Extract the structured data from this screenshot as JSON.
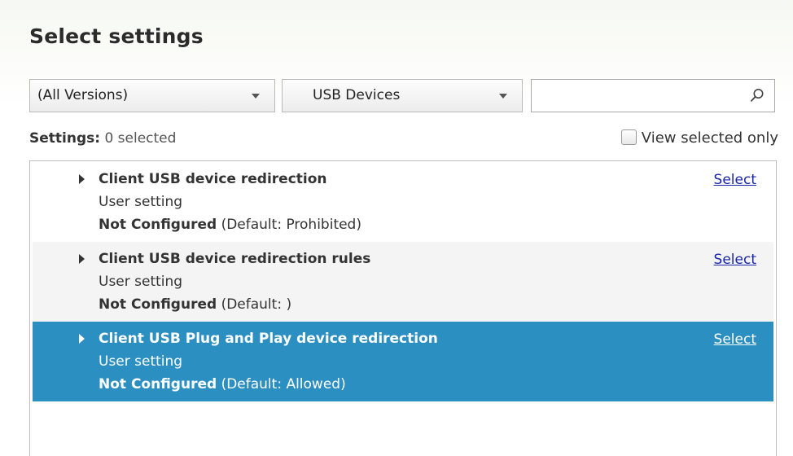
{
  "page": {
    "title": "Select settings"
  },
  "filters": {
    "version_dropdown": "(All Versions)",
    "category_dropdown": "USB Devices",
    "search_value": "",
    "search_placeholder": ""
  },
  "summary": {
    "settings_label": "Settings:",
    "selected_count_text": "0 selected",
    "view_selected_only_label": "View selected only",
    "view_selected_only_checked": false
  },
  "colors": {
    "selected_row_bg": "#2c8fc2",
    "alt_row_bg": "#f4f4f4",
    "link_color": "#1a24a8"
  },
  "settings": [
    {
      "name": "Client USB device redirection",
      "scope": "User setting",
      "state": "Not Configured",
      "default_text": "(Default: Prohibited)",
      "action": "Select",
      "selected": false
    },
    {
      "name": "Client USB device redirection rules",
      "scope": "User setting",
      "state": "Not Configured",
      "default_text": "(Default: )",
      "action": "Select",
      "selected": false
    },
    {
      "name": "Client USB Plug and Play device redirection",
      "scope": "User setting",
      "state": "Not Configured",
      "default_text": "(Default: Allowed)",
      "action": "Select",
      "selected": true
    }
  ]
}
